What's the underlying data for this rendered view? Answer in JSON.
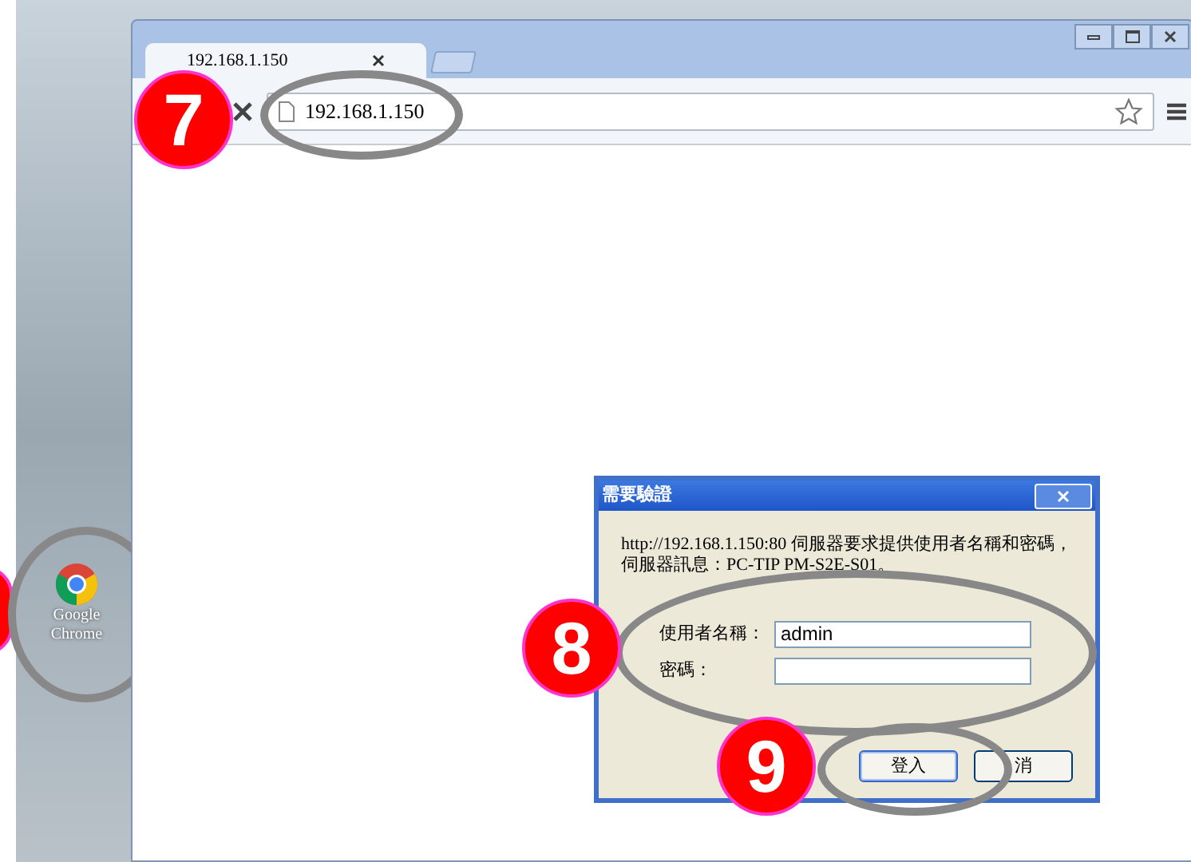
{
  "desktop": {
    "icons": [
      {
        "label": "Google Chrome"
      }
    ]
  },
  "browser": {
    "tabs": [
      {
        "label": "192.168.1.150",
        "selected": true
      }
    ],
    "address_bar": {
      "value": "192.168.1.150"
    }
  },
  "dialog": {
    "title": "需要驗證",
    "message": "http://192.168.1.150:80 伺服器要求提供使用者名稱和密碼，伺服器訊息：PC-TIP PM-S2E-S01。",
    "fields": [
      {
        "label": "使用者名稱：",
        "value": "admin"
      },
      {
        "label": "密碼："
      }
    ],
    "buttons": [
      {
        "label": "登入",
        "focused": true
      },
      {
        "label": "消",
        "focused": false
      }
    ]
  },
  "annotations": [
    {
      "number": "7"
    },
    {
      "number": "8"
    },
    {
      "number": "9"
    }
  ]
}
